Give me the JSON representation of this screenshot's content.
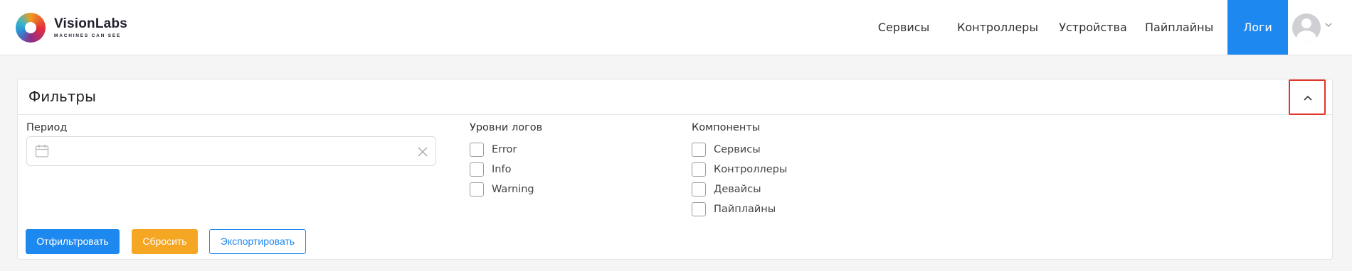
{
  "header": {
    "logo": {
      "name": "VisionLabs",
      "tagline": "MACHINES CAN SEE"
    },
    "nav": [
      {
        "label": "Сервисы",
        "active": false
      },
      {
        "label": "Контроллеры",
        "active": false
      },
      {
        "label": "Устройства",
        "active": false
      },
      {
        "label": "Пайплайны",
        "active": false
      },
      {
        "label": "Логи",
        "active": true
      }
    ],
    "user": {
      "icon": "user-avatar-icon",
      "menu_icon": "chevron-down-icon"
    }
  },
  "filters": {
    "title": "Фильтры",
    "collapse_icon": "chevron-up-icon",
    "period": {
      "label": "Период",
      "value": "",
      "placeholder": "",
      "icon": "calendar-icon",
      "clear_icon": "close-icon"
    },
    "log_levels": {
      "label": "Уровни логов",
      "options": [
        {
          "label": "Error",
          "checked": false
        },
        {
          "label": "Info",
          "checked": false
        },
        {
          "label": "Warning",
          "checked": false
        }
      ]
    },
    "components": {
      "label": "Компоненты",
      "options": [
        {
          "label": "Сервисы",
          "checked": false
        },
        {
          "label": "Контроллеры",
          "checked": false
        },
        {
          "label": "Девайсы",
          "checked": false
        },
        {
          "label": "Пайплайны",
          "checked": false
        }
      ]
    },
    "actions": {
      "filter_label": "Отфильтровать",
      "reset_label": "Сбросить",
      "export_label": "Экспортировать"
    }
  },
  "colors": {
    "accent": "#1e88f1",
    "warning": "#f5a623",
    "highlight": "#e0352b"
  }
}
